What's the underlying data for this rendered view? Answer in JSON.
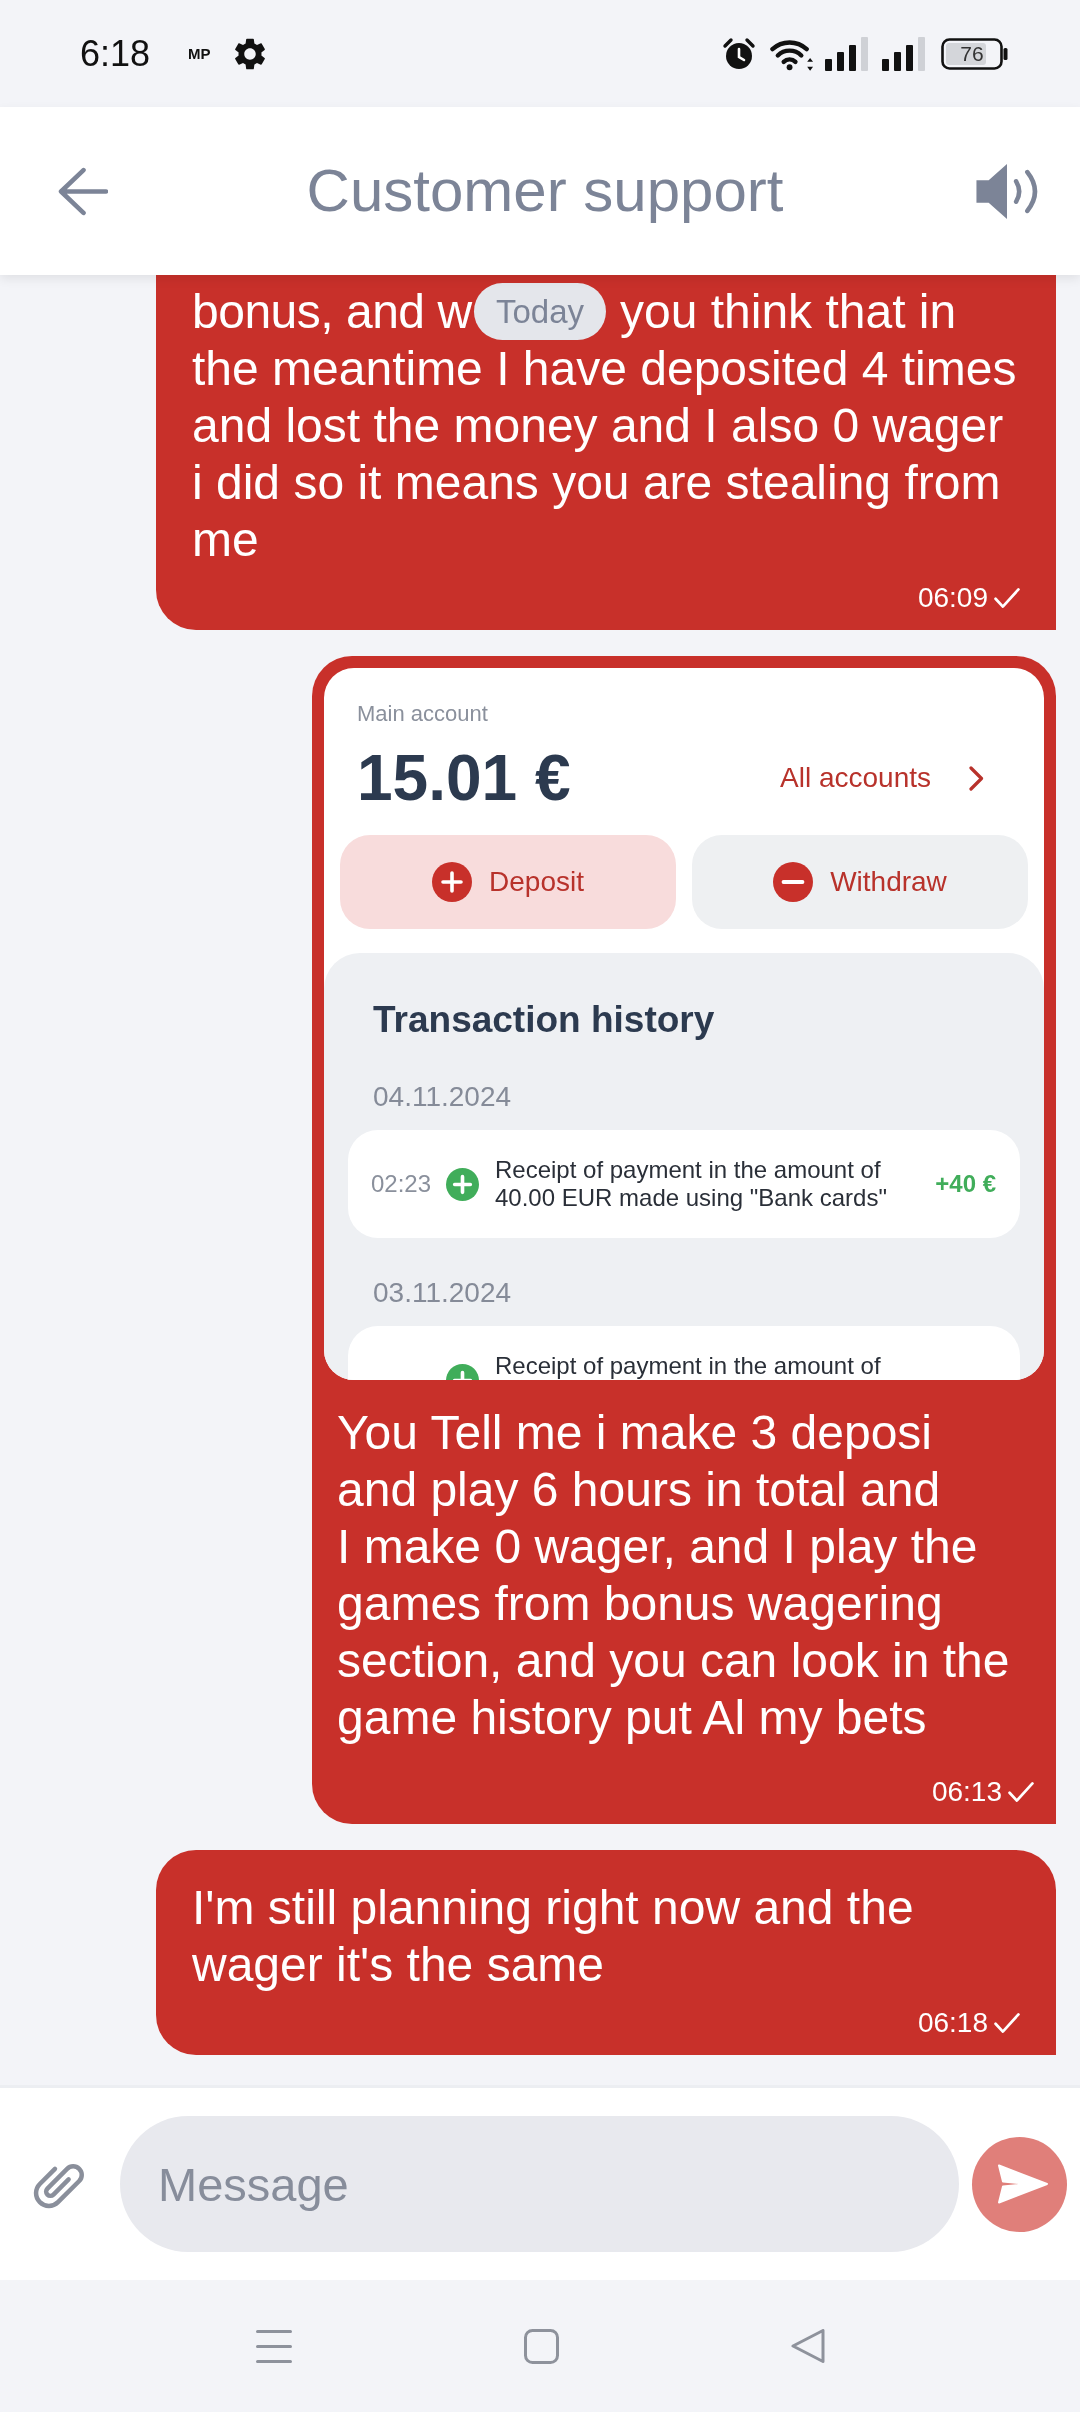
{
  "status_bar": {
    "time": "6:18",
    "badge": "MP",
    "battery": "76"
  },
  "header": {
    "title": "Customer support"
  },
  "date_label": "Today",
  "messages": [
    {
      "kind": "text",
      "top_line_parts": [
        "bonus, and w",
        "you think that in"
      ],
      "text": "the meantime I have deposited 4 times and lost the money and I also 0 wager i did so it means you are stealing from me",
      "time": "06:09",
      "sent": true
    },
    {
      "kind": "image",
      "screenshot": {
        "account_label": "Main account",
        "balance": "15.01 €",
        "accounts_link": "All accounts",
        "actions": [
          {
            "kind": "add",
            "label": "Deposit"
          },
          {
            "kind": "remove",
            "label": "Withdraw"
          }
        ],
        "history_title": "Transaction history",
        "groups": [
          {
            "date": "04.11.2024",
            "transactions": [
              {
                "time": "02:23",
                "description": "Receipt of payment in the amount of 40.00 EUR made using \"Bank cards\"",
                "amount": "+40 €"
              }
            ]
          },
          {
            "date": "03.11.2024",
            "transactions": [
              {
                "description": "Receipt of payment in the amount of"
              }
            ]
          }
        ]
      },
      "text": "You Tell me i make 3 deposi and play 6 hours in total and\nI make 0 wager, and I play the games from bonus wagering section, and you can look in the game history put Al my bets",
      "time": "06:13",
      "sent": true
    },
    {
      "kind": "text",
      "text": "I'm still planning right now and the wager it's the same",
      "time": "06:18",
      "sent": true
    }
  ],
  "composer": {
    "placeholder": "Message",
    "send_disabled": true
  }
}
